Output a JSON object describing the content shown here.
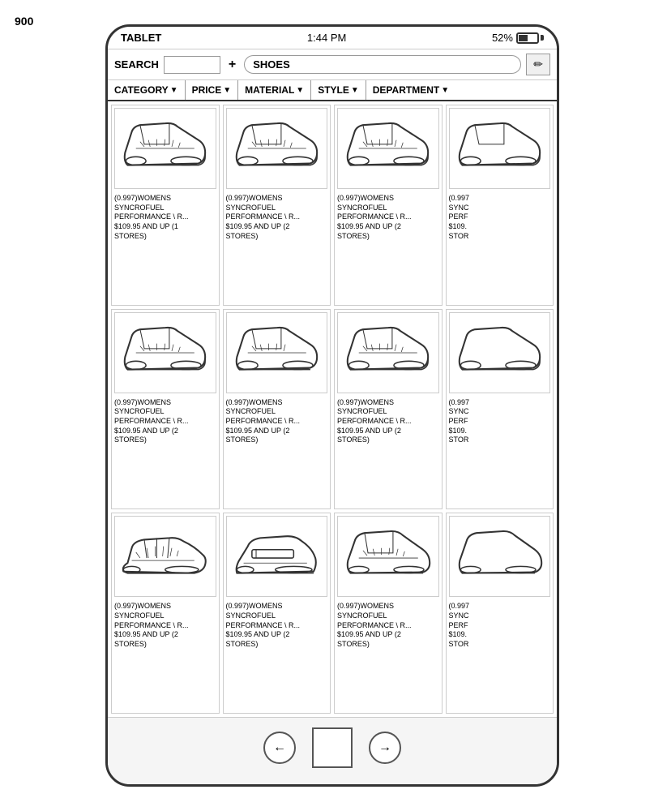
{
  "figure": {
    "label": "900",
    "arrow": "↘"
  },
  "status_bar": {
    "left": "TABLET",
    "center": "1:44 PM",
    "right_text": "52%"
  },
  "search_bar": {
    "label": "SEARCH",
    "input_placeholder": "",
    "plus": "+",
    "pill_text": "SHOES",
    "icon_label": "✏"
  },
  "filters": [
    {
      "label": "CATEGORY",
      "arrow": "▼"
    },
    {
      "label": "PRICE",
      "arrow": "▼"
    },
    {
      "label": "MATERIAL",
      "arrow": "▼"
    },
    {
      "label": "STYLE",
      "arrow": "▼"
    },
    {
      "label": "DEPARTMENT",
      "arrow": "▼"
    }
  ],
  "products": [
    {
      "id": 1,
      "score": "(0.997)",
      "name": "WOMENS SYNCROFUEL PERFORMANCE \\ R...",
      "price": "$109.95 AND UP (1 STORES)"
    },
    {
      "id": 2,
      "score": "(0.997)",
      "name": "WOMENS SYNCROFUEL PERFORMANCE \\ R...",
      "price": "$109.95 AND UP (2 STORES)"
    },
    {
      "id": 3,
      "score": "(0.997)",
      "name": "WOMENS SYNCROFUEL PERFORMANCE \\ R...",
      "price": "$109.95 AND UP (2 STORES)"
    },
    {
      "id": 4,
      "score": "(0.997",
      "name": "SYNC PERF",
      "price": "$109. STOR"
    },
    {
      "id": 5,
      "score": "(0.997)",
      "name": "WOMENS SYNCROFUEL PERFORMANCE \\ R...",
      "price": "$109.95 AND UP (2 STORES)"
    },
    {
      "id": 6,
      "score": "(0.997)",
      "name": "WOMENS SYNCROFUEL PERFORMANCE \\ R...",
      "price": "$109.95 AND UP (2 STORES)"
    },
    {
      "id": 7,
      "score": "(0.997)",
      "name": "WOMENS SYNCROFUEL PERFORMANCE \\ R...",
      "price": "$109.95 AND UP (2 STORES)"
    },
    {
      "id": 8,
      "score": "(0.997",
      "name": "SYNC PERF",
      "price": "$109. STOR"
    },
    {
      "id": 9,
      "score": "(0.997)",
      "name": "WOMENS SYNCROFUEL PERFORMANCE \\ R...",
      "price": "$109.95 AND UP (2 STORES)"
    },
    {
      "id": 10,
      "score": "(0.997)",
      "name": "WOMENS SYNCROFUEL PERFORMANCE \\ R...",
      "price": "$109.95 AND UP (2 STORES)"
    },
    {
      "id": 11,
      "score": "(0.997)",
      "name": "WOMENS SYNCROFUEL PERFORMANCE \\ R...",
      "price": "$109.95 AND UP (2 STORES)"
    },
    {
      "id": 12,
      "score": "(0.997",
      "name": "SYNC PERF",
      "price": "$109. STOR"
    }
  ],
  "nav": {
    "back": "←",
    "forward": "→"
  }
}
